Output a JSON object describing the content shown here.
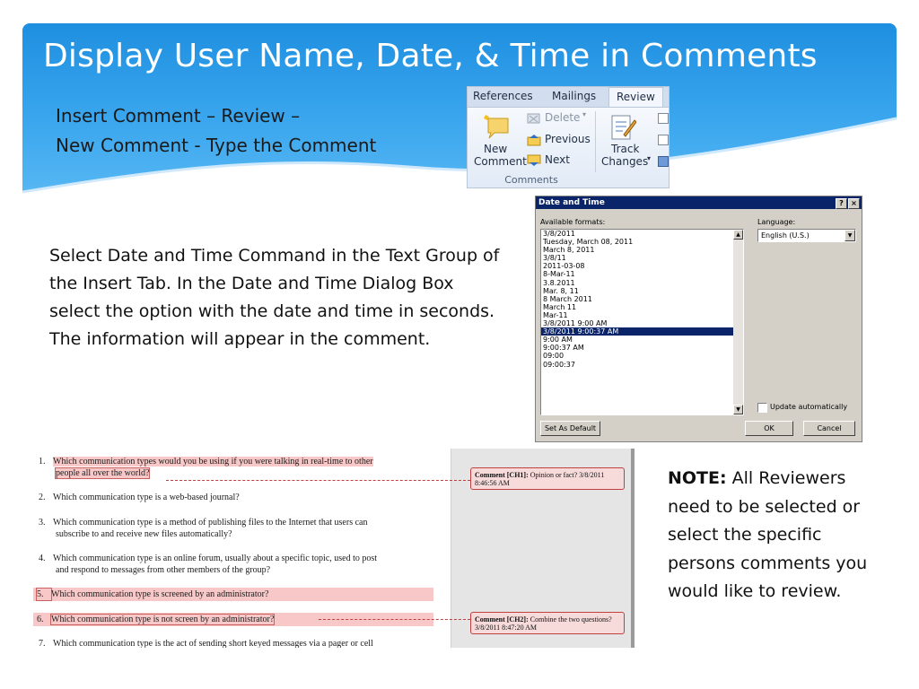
{
  "slide": {
    "title": "Display User Name, Date, & Time in Comments",
    "subtitle_line1": "Insert Comment – Review –",
    "subtitle_line2": "New Comment - Type the Comment",
    "body": "Select Date and Time Command in the Text Group of the Insert Tab. In the Date and Time Dialog Box select the option with the date and time in seconds. The information will appear in the comment.",
    "note_label": "NOTE:",
    "note_text": " All Reviewers need to be selected or select the specific persons comments you would like to review.",
    "colors": {
      "banner": "#1e8fe0",
      "dialog_title": "#0a246a",
      "comment_fill": "#f7dada",
      "highlight": "#f8c8c8"
    }
  },
  "ribbon": {
    "tabs": [
      "References",
      "Mailings",
      "Review"
    ],
    "active_tab": "Review",
    "new_comment_line1": "New",
    "new_comment_line2": "Comment",
    "delete": "Delete",
    "previous": "Previous",
    "next": "Next",
    "track_line1": "Track",
    "track_line2": "Changes",
    "group_label": "Comments",
    "icons": [
      "new-comment-icon",
      "delete-icon",
      "previous-icon",
      "next-icon",
      "track-changes-icon"
    ]
  },
  "dialog": {
    "title": "Date and Time",
    "help_btn": "?",
    "close_btn": "×",
    "available_label": "Available formats:",
    "language_label": "Language:",
    "language_value": "English (U.S.)",
    "formats": [
      "3/8/2011",
      "Tuesday, March 08, 2011",
      "March 8, 2011",
      "3/8/11",
      "2011-03-08",
      "8-Mar-11",
      "3.8.2011",
      "Mar. 8, 11",
      "8 March 2011",
      "March 11",
      "Mar-11",
      "3/8/2011 9:00 AM",
      "3/8/2011 9:00:37 AM",
      "9:00 AM",
      "9:00:37 AM",
      "09:00",
      "09:00:37"
    ],
    "selected_format": "3/8/2011 9:00:37 AM",
    "update_label": "Update automatically",
    "update_checked": false,
    "set_default": "Set As Default",
    "ok": "OK",
    "cancel": "Cancel"
  },
  "document": {
    "questions": [
      {
        "num": "1.",
        "line1": "Which communication types would you be using if you were talking in real-time to other",
        "line2": "people all over the world?"
      },
      {
        "num": "2.",
        "line1": "Which communication type is a web-based journal?"
      },
      {
        "num": "3.",
        "line1": "Which communication type is a method of publishing  files to the Internet that users can",
        "line2": "subscribe to and receive new files automatically?"
      },
      {
        "num": "4.",
        "line1": "Which communication type is an online forum, usually about a specific topic, used to post",
        "line2": "and respond to messages  from other members of the group?"
      },
      {
        "num": "5.",
        "line1": "Which communication type is screened by an administrator?"
      },
      {
        "num": "6.",
        "line1": "Which communication type is not screen by an administrator?"
      },
      {
        "num": "7.",
        "line1": "Which communication type is the act of sending short keyed messages  via a pager or cell"
      }
    ],
    "comments": [
      {
        "label": "Comment [CH1]:",
        "text": " Opinion or fact? 3/8/2011 8:46:56 AM"
      },
      {
        "label": "Comment [CH2]:",
        "text": " Combine the two questions? 3/8/2011 8:47:20 AM"
      }
    ]
  }
}
